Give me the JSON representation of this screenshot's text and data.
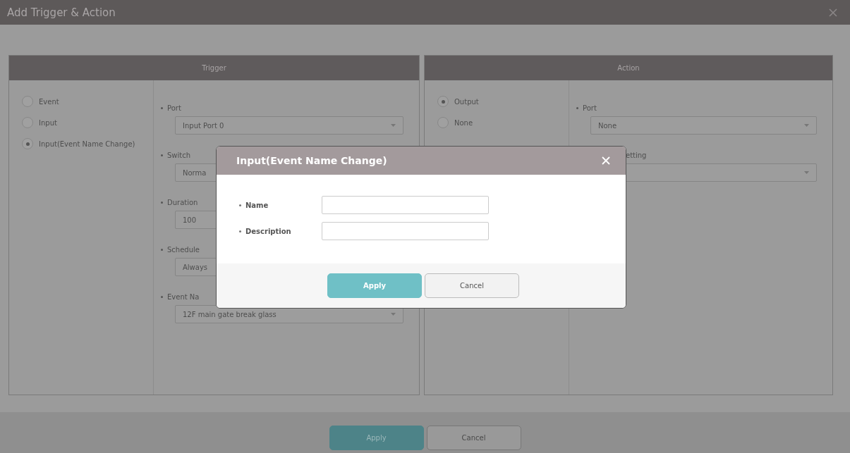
{
  "window": {
    "title": "Add Trigger & Action"
  },
  "trigger": {
    "title": "Trigger",
    "options": [
      {
        "label": "Event",
        "selected": false
      },
      {
        "label": "Input",
        "selected": false
      },
      {
        "label": "Input(Event Name Change)",
        "selected": true
      }
    ],
    "fields": [
      {
        "label": "Port",
        "value": "Input Port 0",
        "kind": "select"
      },
      {
        "label": "Switch",
        "value": "Norma",
        "kind": "select"
      },
      {
        "label": "Duration",
        "value": "100",
        "kind": "input"
      },
      {
        "label": "Schedule",
        "value": "Always",
        "kind": "select"
      },
      {
        "label": "Event Na",
        "value": "12F main gate break glass",
        "kind": "select"
      }
    ]
  },
  "action": {
    "title": "Action",
    "options": [
      {
        "label": "Output",
        "selected": true
      },
      {
        "label": "None",
        "selected": false
      }
    ],
    "fields": [
      {
        "label": "Port",
        "value": "None",
        "kind": "select"
      },
      {
        "label": "etting",
        "kind": "select"
      }
    ]
  },
  "dialog": {
    "title": "Input(Event Name Change)",
    "fields": [
      {
        "label": "Name"
      },
      {
        "label": "Description"
      }
    ],
    "buttons": [
      "Apply",
      "Cancel"
    ]
  },
  "buttons": [
    "Apply",
    "Cancel"
  ]
}
